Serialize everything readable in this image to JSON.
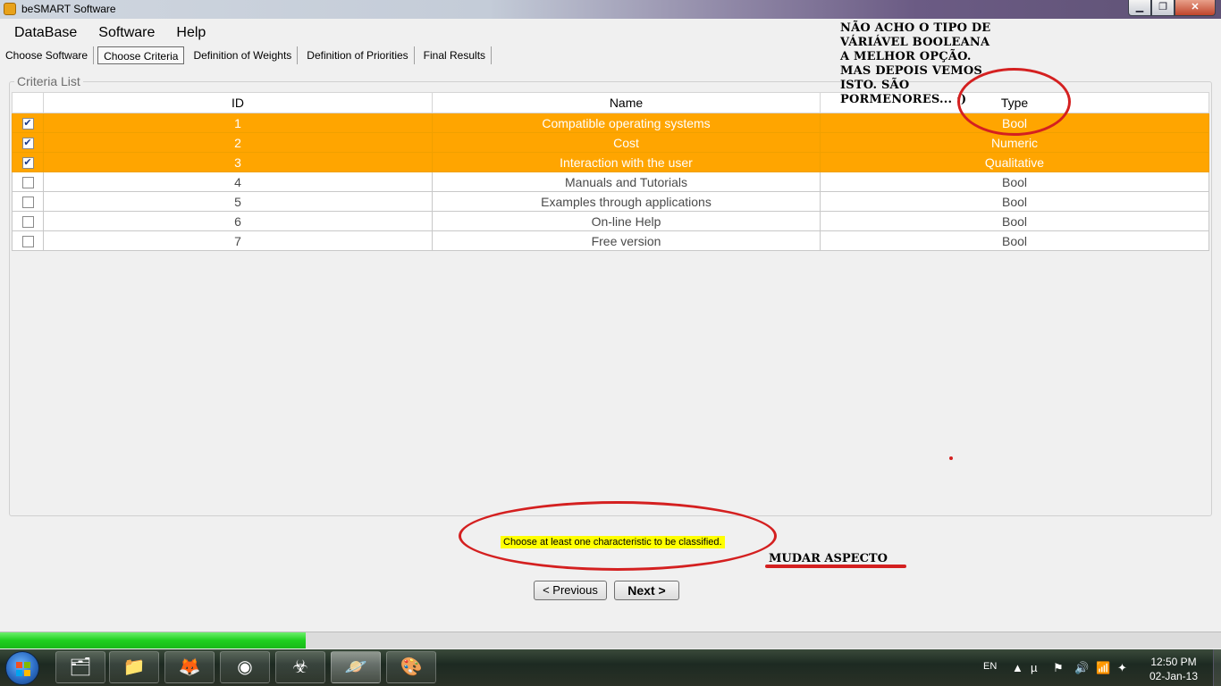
{
  "window": {
    "title": "beSMART Software",
    "controls": [
      "minimize",
      "maximize",
      "close"
    ]
  },
  "menu": [
    "DataBase",
    "Software",
    "Help"
  ],
  "tabs": [
    {
      "label": "Choose Software",
      "active": false
    },
    {
      "label": "Choose Criteria",
      "active": true
    },
    {
      "label": "Definition of Weights",
      "active": false
    },
    {
      "label": "Definition of Priorities",
      "active": false
    },
    {
      "label": "Final Results",
      "active": false
    }
  ],
  "criteria": {
    "group_title": "Criteria List",
    "columns": [
      "ID",
      "Name",
      "Type"
    ],
    "rows": [
      {
        "checked": true,
        "id": "1",
        "name": "Compatible operating systems",
        "type": "Bool"
      },
      {
        "checked": true,
        "id": "2",
        "name": "Cost",
        "type": "Numeric"
      },
      {
        "checked": true,
        "id": "3",
        "name": "Interaction with the user",
        "type": "Qualitative"
      },
      {
        "checked": false,
        "id": "4",
        "name": "Manuals and Tutorials",
        "type": "Bool"
      },
      {
        "checked": false,
        "id": "5",
        "name": "Examples through applications",
        "type": "Bool"
      },
      {
        "checked": false,
        "id": "6",
        "name": "On-line Help",
        "type": "Bool"
      },
      {
        "checked": false,
        "id": "7",
        "name": "Free version",
        "type": "Bool"
      }
    ],
    "selected_color": "#ffa500"
  },
  "annotations": {
    "note_top": [
      "NÃO ACHO O TIPO DE",
      "VÁRIÁVEL BOOLEANA",
      "A MELHOR OPÇÃO.",
      "MAS DEPOIS VEMOS",
      "ISTO. SÃO",
      "PORMENORES... :)"
    ],
    "note_bottom": "MUDAR ASPECTO",
    "marker_color": "#d42020"
  },
  "status_message": "Choose at least one characteristic to be classified.",
  "buttons": {
    "previous": "< Previous",
    "next": "Next   >"
  },
  "progress": {
    "value": 0.25
  },
  "taskbar": {
    "apps": [
      "file-manager-icon",
      "folder-icon",
      "firefox-icon",
      "chrome-icon",
      "foobar-icon",
      "besmart-icon",
      "paint-icon"
    ],
    "language": "EN",
    "time": "12:50 PM",
    "date": "02-Jan-13"
  }
}
